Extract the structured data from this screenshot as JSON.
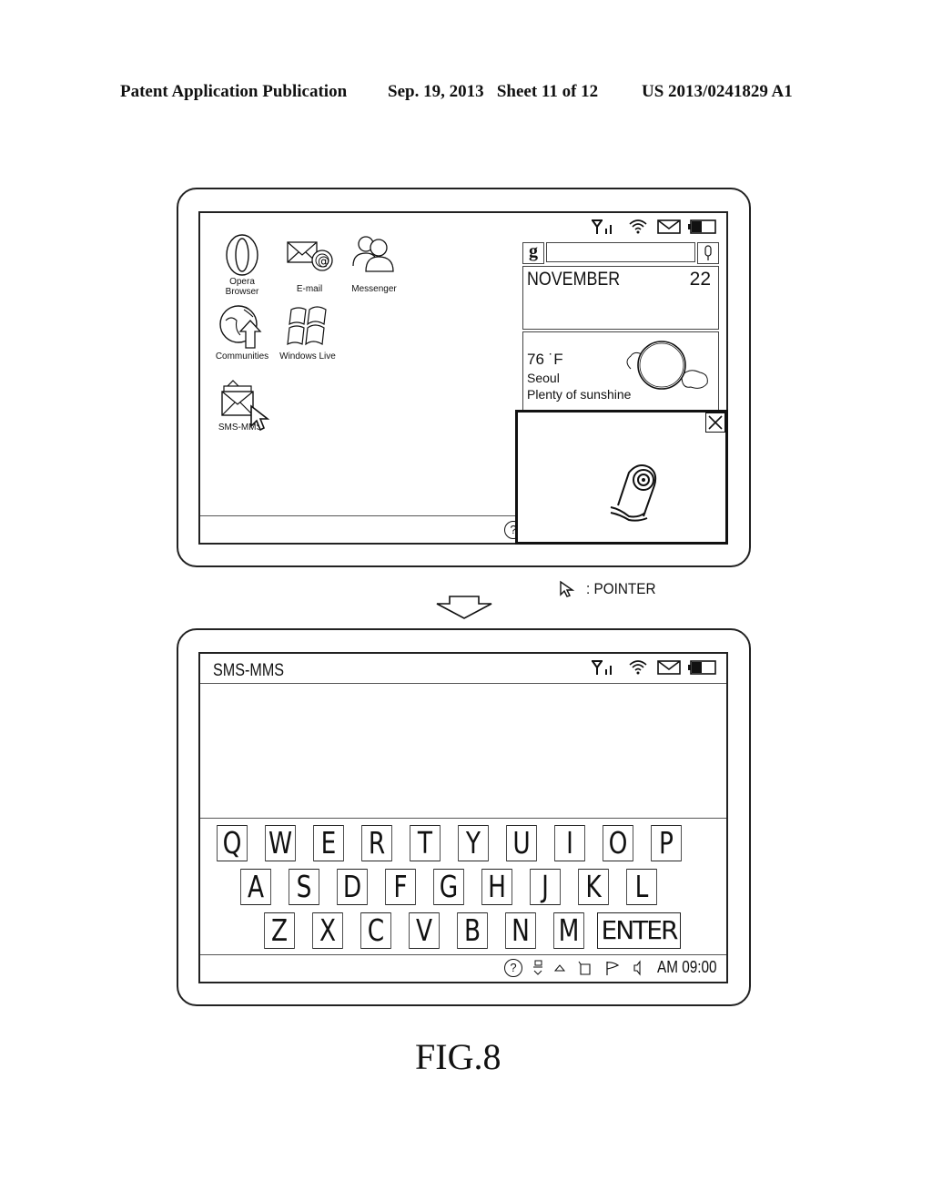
{
  "header": {
    "left": "Patent Application Publication",
    "date_sheet": "Sep. 19, 2013   Sheet 11 of 12",
    "number": "US 2013/0241829 A1"
  },
  "top_screen": {
    "apps": [
      {
        "label_line1": "Opera",
        "label_line2": "Browser",
        "icon": "opera-icon"
      },
      {
        "label_line1": "E-mail",
        "label_line2": "",
        "icon": "email-icon"
      },
      {
        "label_line1": "Messenger",
        "label_line2": "",
        "icon": "messenger-icon"
      },
      {
        "label_line1": "Communities",
        "label_line2": "",
        "icon": "communities-icon"
      },
      {
        "label_line1": "Windows Live",
        "label_line2": "",
        "icon": "windows-live-icon"
      },
      {
        "label_line1": "SMS-MMS",
        "label_line2": "",
        "icon": "sms-mms-icon"
      }
    ],
    "search": {
      "g_label": "g",
      "value": "",
      "placeholder": ""
    },
    "calendar": {
      "month": "NOVEMBER",
      "day": "22"
    },
    "weather": {
      "temp": "76 ˙F",
      "city": "Seoul",
      "desc": "Plenty of sunshine"
    },
    "help_label": "?"
  },
  "legend": {
    "pointer_label": ": POINTER"
  },
  "bottom_screen": {
    "title": "SMS-MMS",
    "keyboard": {
      "row1": [
        "Q",
        "W",
        "E",
        "R",
        "T",
        "Y",
        "U",
        "I",
        "O",
        "P"
      ],
      "row2": [
        "A",
        "S",
        "D",
        "F",
        "G",
        "H",
        "J",
        "K",
        "L"
      ],
      "row3": [
        "Z",
        "X",
        "C",
        "V",
        "B",
        "N",
        "M"
      ],
      "enter": "ENTER"
    },
    "taskbar": {
      "help": "?",
      "clock": "AM 09:00"
    }
  },
  "figure_label": "FIG.8"
}
